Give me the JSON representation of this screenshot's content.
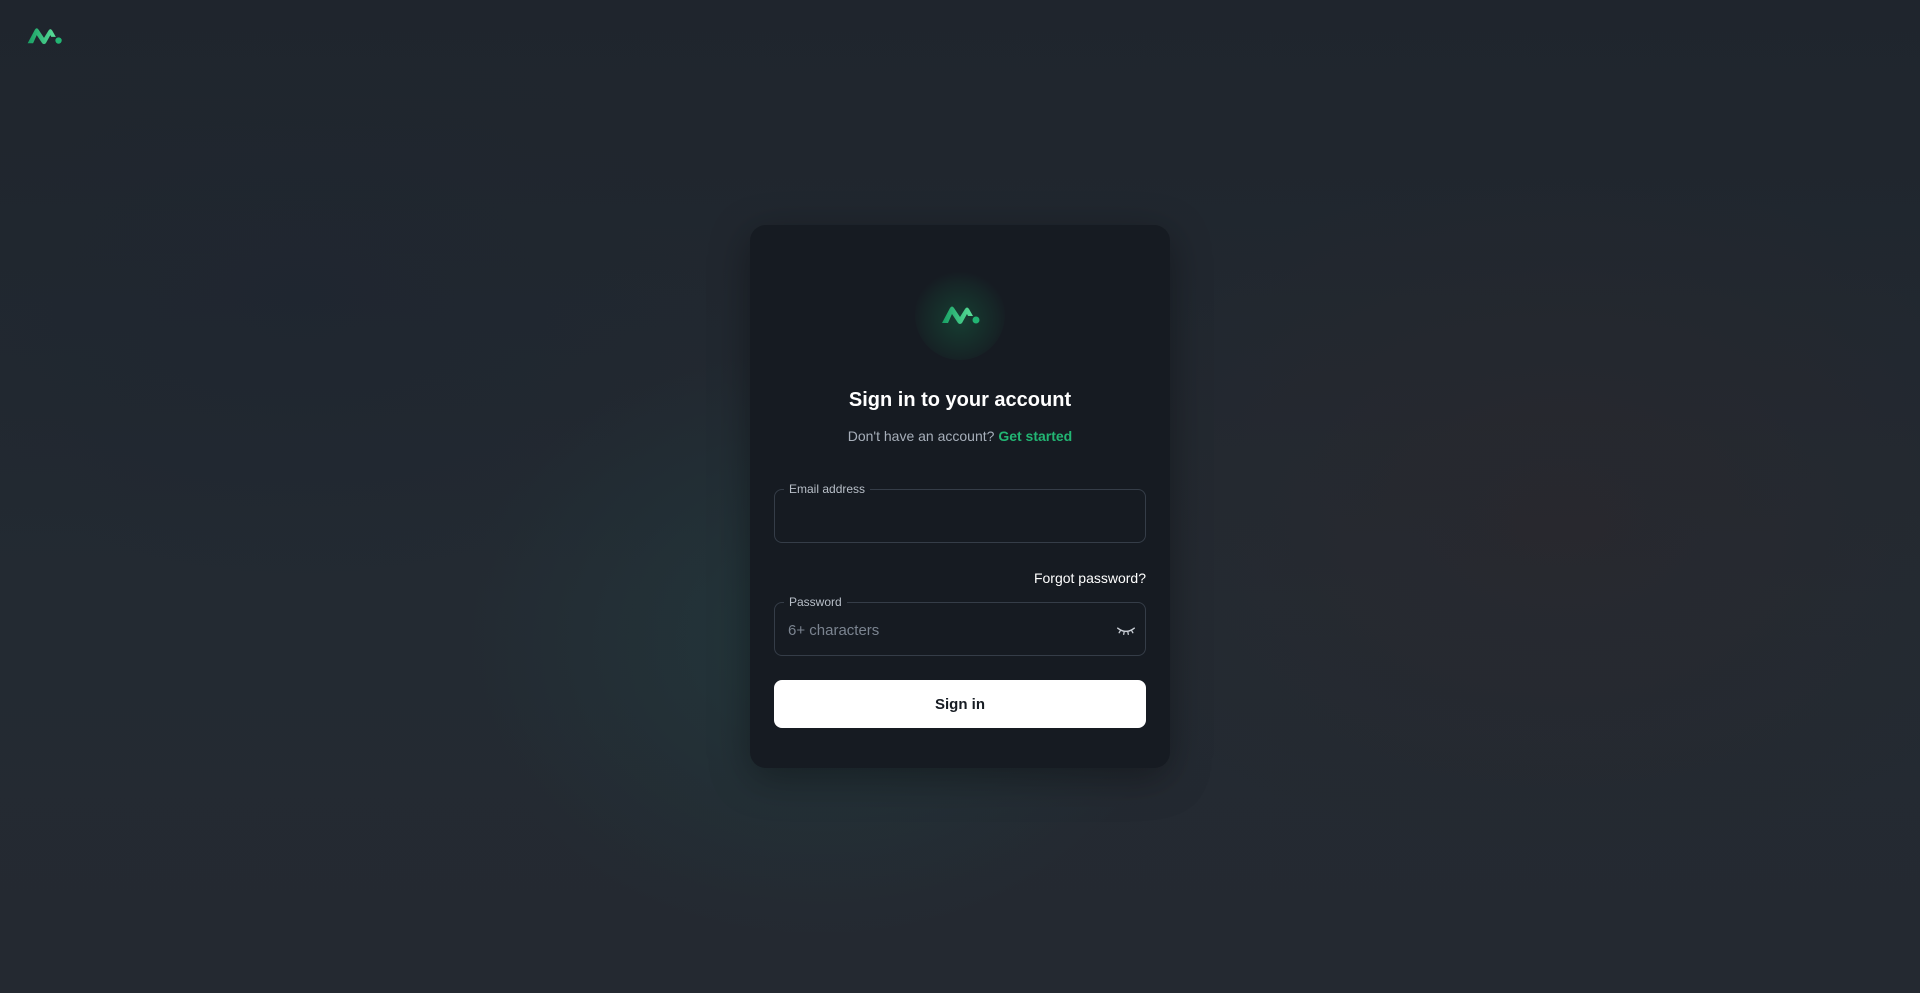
{
  "brand": {
    "logo_icon": "brand-logo-icon",
    "accent_color": "#22b573",
    "accent_light": "#5be09a"
  },
  "login": {
    "title": "Sign in to your account",
    "subtitle_prefix": "Don't have an account?",
    "subtitle_link": "Get started",
    "email": {
      "label": "Email address",
      "value": "",
      "placeholder": ""
    },
    "forgot_password": "Forgot password?",
    "password": {
      "label": "Password",
      "value": "",
      "placeholder": "6+ characters",
      "toggle_icon": "eye-closed-icon"
    },
    "submit_label": "Sign in"
  }
}
